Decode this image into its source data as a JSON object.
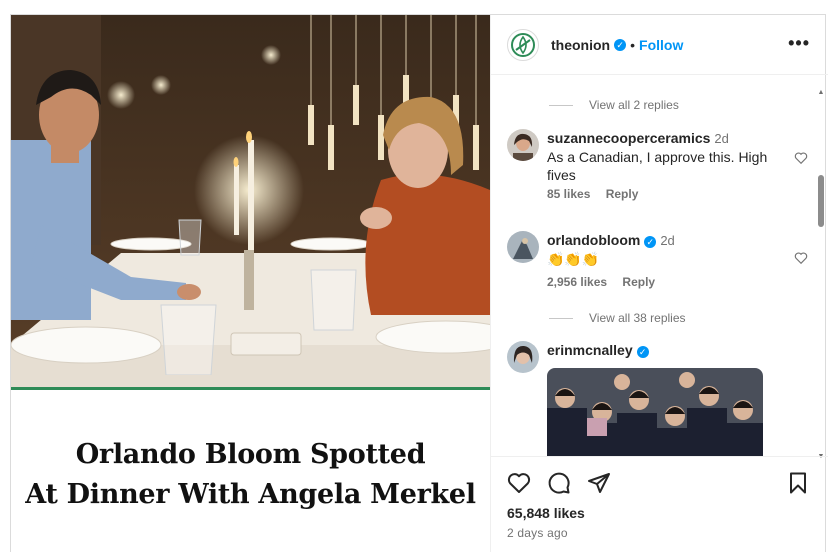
{
  "post": {
    "headline_line1": "Orlando Bloom Spotted",
    "headline_line2": "At Dinner With Angela Merkel",
    "likes": "65,848 likes",
    "time_ago": "2 days ago"
  },
  "header": {
    "username": "theonion",
    "separator": "•",
    "follow_label": "Follow",
    "more_label": "•••",
    "verified_mark": "✓"
  },
  "comments": {
    "top_view_replies": "View all 2 replies",
    "items": [
      {
        "username": "suzannecooperceramics",
        "age": "2d",
        "text": "As a Canadian, I approve this. High fives",
        "likes": "85 likes",
        "reply_label": "Reply",
        "verified": false
      },
      {
        "username": "orlandobloom",
        "age": "2d",
        "text": "👏👏👏",
        "likes": "2,956 likes",
        "reply_label": "Reply",
        "verified": true,
        "view_replies": "View all 38 replies"
      },
      {
        "username": "erinmcnalley",
        "verified": true
      }
    ]
  },
  "icons": {
    "header_avatar": "onion-logo-icon",
    "verified": "verified-badge-icon",
    "more": "more-options-icon",
    "like": "heart-icon",
    "comment": "comment-icon",
    "share": "share-icon",
    "save": "bookmark-icon"
  },
  "colors": {
    "accent_blue": "#0095f6",
    "onion_green": "#2e8b57",
    "text_primary": "#262626",
    "text_secondary": "#737373"
  }
}
